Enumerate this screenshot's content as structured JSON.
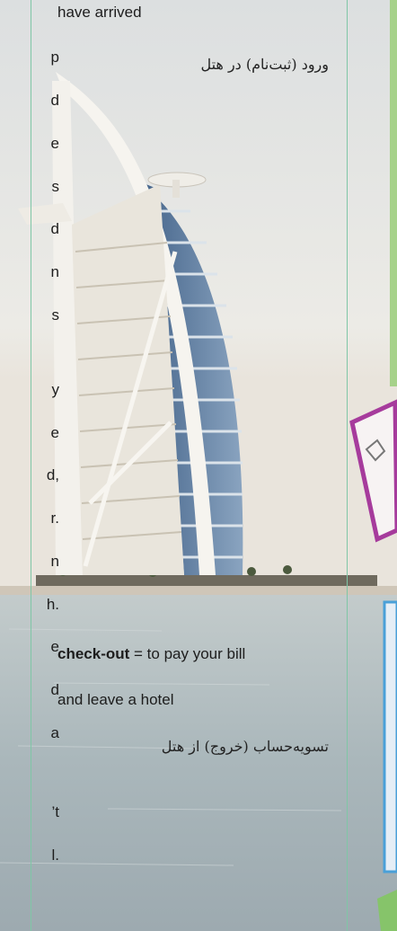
{
  "main": {
    "line1": "have arrived",
    "fa1": "ورود (ثبت‌نام) در هتل",
    "def2_term": "check-out",
    "def2_rest": " = to pay your bill",
    "def2_line2": "and leave a hotel",
    "fa2": "تسویه‌حساب (خروج) از هتل"
  },
  "left_column_fragments": [
    "p",
    "d",
    "e",
    "s",
    "d",
    "n",
    "s",
    "y",
    "e",
    "d,",
    "r.",
    "n",
    "h.",
    "e",
    "d",
    "a",
    "’t",
    "l."
  ],
  "colors": {
    "guide_line": "#7fc6a6",
    "sky": "#e7e8e6",
    "water": "#b9c4c6",
    "tower": "#f3f1ec",
    "glass": "#4f6f94"
  }
}
